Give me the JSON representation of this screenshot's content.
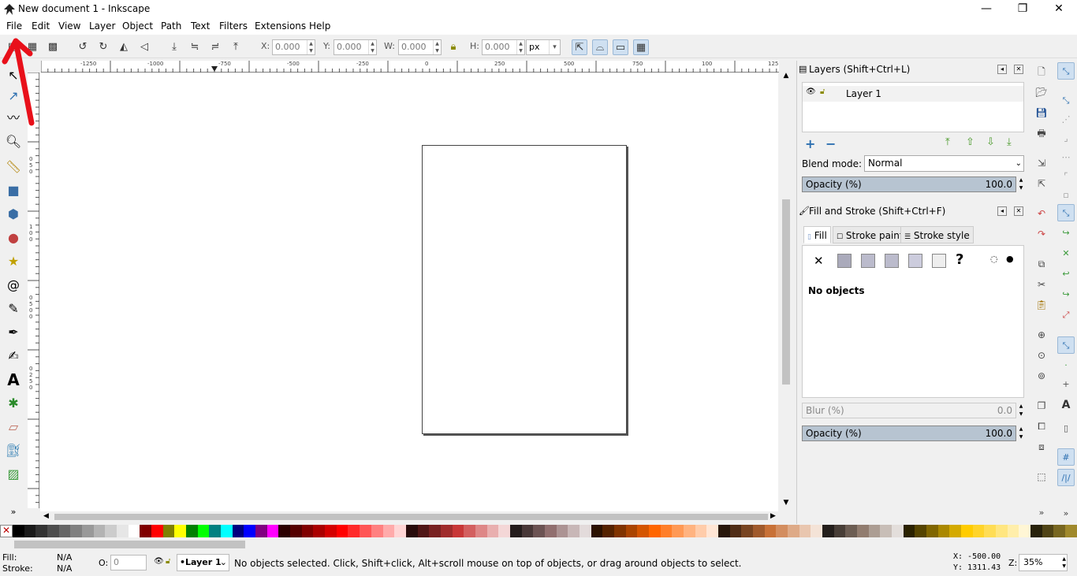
{
  "window": {
    "title": "New document 1 - Inkscape",
    "minimize": "—",
    "maximize": "❐",
    "close": "✕"
  },
  "menu": [
    "File",
    "Edit",
    "View",
    "Layer",
    "Object",
    "Path",
    "Text",
    "Filters",
    "Extensions",
    "Help"
  ],
  "controls": {
    "x_label": "X:",
    "x_value": "0.000",
    "y_label": "Y:",
    "y_value": "0.000",
    "w_label": "W:",
    "w_value": "0.000",
    "h_label": "H:",
    "h_value": "0.000",
    "unit": "px"
  },
  "ruler": {
    "h_ticks": [
      "-1250",
      "-1000",
      "-750",
      "-500",
      "-250",
      "0",
      "250",
      "500",
      "750",
      "100",
      "125"
    ],
    "v_ticks": [
      "0",
      "5",
      "0",
      "1",
      "0",
      "0",
      "0",
      "5",
      "0",
      "0",
      "0",
      "2",
      "5",
      "0"
    ]
  },
  "layers_panel": {
    "title": "Layers (Shift+Ctrl+L)",
    "layer_name": "Layer 1",
    "blend_label": "Blend mode:",
    "blend_value": "Normal",
    "opacity_label": "Opacity (%)",
    "opacity_value": "100.0"
  },
  "fill_stroke_panel": {
    "title": "Fill and Stroke (Shift+Ctrl+F)",
    "tabs": [
      "Fill",
      "Stroke paint",
      "Stroke style"
    ],
    "no_objects": "No objects",
    "blur_label": "Blur (%)",
    "blur_value": "0.0",
    "opacity_label": "Opacity (%)",
    "opacity_value": "100.0"
  },
  "status": {
    "fill_label": "Fill:",
    "fill_value": "N/A",
    "stroke_label": "Stroke:",
    "stroke_value": "N/A",
    "o_label": "O:",
    "o_value": "0",
    "layer": "•Layer 1",
    "message": "No objects selected. Click, Shift+click, Alt+scroll mouse on top of objects, or drag around objects to select.",
    "x_coord": "X: -500.00",
    "y_coord": "Y: 1311.43",
    "zoom_label": "Z:",
    "zoom_value": "35%"
  },
  "palette": [
    "#000000",
    "#1a1a1a",
    "#333333",
    "#4d4d4d",
    "#666666",
    "#808080",
    "#999999",
    "#b3b3b3",
    "#cccccc",
    "#e6e6e6",
    "#ffffff",
    "#800000",
    "#ff0000",
    "#808000",
    "#ffff00",
    "#008000",
    "#00ff00",
    "#008080",
    "#00ffff",
    "#000080",
    "#0000ff",
    "#800080",
    "#ff00ff",
    "#2b0000",
    "#550000",
    "#800000",
    "#aa0000",
    "#d40000",
    "#ff0000",
    "#ff2a2a",
    "#ff5555",
    "#ff8080",
    "#ffaaaa",
    "#ffd5d5",
    "#280b0b",
    "#501616",
    "#782121",
    "#a02c2c",
    "#c83737",
    "#d35f5f",
    "#de8787",
    "#e9afaf",
    "#f4d7d7",
    "#241c1c",
    "#483737",
    "#6c5353",
    "#916f6f",
    "#ac9393",
    "#c8b7b7",
    "#e3dbdb",
    "#2b1100",
    "#552200",
    "#803300",
    "#aa4400",
    "#d45500",
    "#ff6600",
    "#ff7f2a",
    "#ff9955",
    "#ffb380",
    "#ffccaa",
    "#ffe6d5",
    "#28170b",
    "#502d16",
    "#784421",
    "#a05a2c",
    "#c87137",
    "#d38d5f",
    "#deaa87",
    "#e9c6af",
    "#f4e3d7",
    "#241f1c",
    "#483e37",
    "#6c5d53",
    "#917c6f",
    "#ac9d93",
    "#c8beb7",
    "#e3dedb",
    "#2b2200",
    "#554400",
    "#806600",
    "#aa8800",
    "#d4aa00",
    "#ffcc00",
    "#ffd42a",
    "#ffdd55",
    "#ffe680",
    "#ffeeaa",
    "#fff6d5",
    "#28220b",
    "#504416",
    "#786721",
    "#a0892c"
  ],
  "annotation": {
    "arrow_color": "#e8101a"
  }
}
